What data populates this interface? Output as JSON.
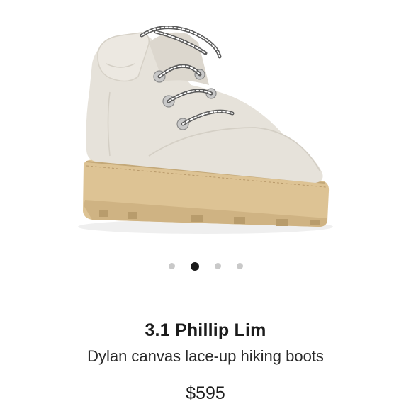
{
  "product": {
    "brand": "3.1 Phillip Lim",
    "name": "Dylan canvas lace-up hiking boots",
    "price": "$595",
    "image_icon": "hiking-boot-illustration"
  },
  "carousel": {
    "total": 4,
    "active_index": 1
  },
  "colors": {
    "boot_upper": "#e6e2da",
    "sole": "#ddc394",
    "dot_active": "#1a1a1a",
    "dot_inactive": "#c9c9c9"
  }
}
